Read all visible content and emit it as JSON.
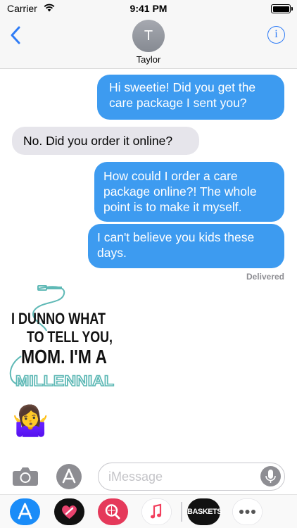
{
  "status_bar": {
    "carrier": "Carrier",
    "time": "9:41 PM"
  },
  "header": {
    "contact_initial": "T",
    "contact_name": "Taylor",
    "info_icon": "i"
  },
  "messages": [
    {
      "sender": "me",
      "text": "Hi sweetie! Did you get the care package I sent you?"
    },
    {
      "sender": "Taylor",
      "text": "No. Did you order it online?"
    },
    {
      "sender": "me",
      "text": "How could I order a care package online?! The whole point is to make it myself."
    },
    {
      "sender": "me",
      "text": "I can't believe you kids these days."
    }
  ],
  "delivery_status": "Delivered",
  "sticker": {
    "line1": "I DUNNO WHAT",
    "line2": "TO TELL YOU,",
    "line3": "MOM. I'M A",
    "line4": "MILLENNIAL",
    "accent_color": "#5fb9b6"
  },
  "emoji_message": "🤷‍♀️",
  "composer": {
    "placeholder": "iMessage"
  },
  "app_drawer": {
    "apps": [
      "app-store-icon",
      "digital-touch-icon",
      "search-images-icon",
      "music-icon",
      "baskets-sticker-icon",
      "more-icon"
    ],
    "baskets_label": "BASKETS"
  },
  "colors": {
    "sent_bubble": "#3d9bf0",
    "received_bubble": "#e6e5eb",
    "accent": "#2f7cf6"
  }
}
